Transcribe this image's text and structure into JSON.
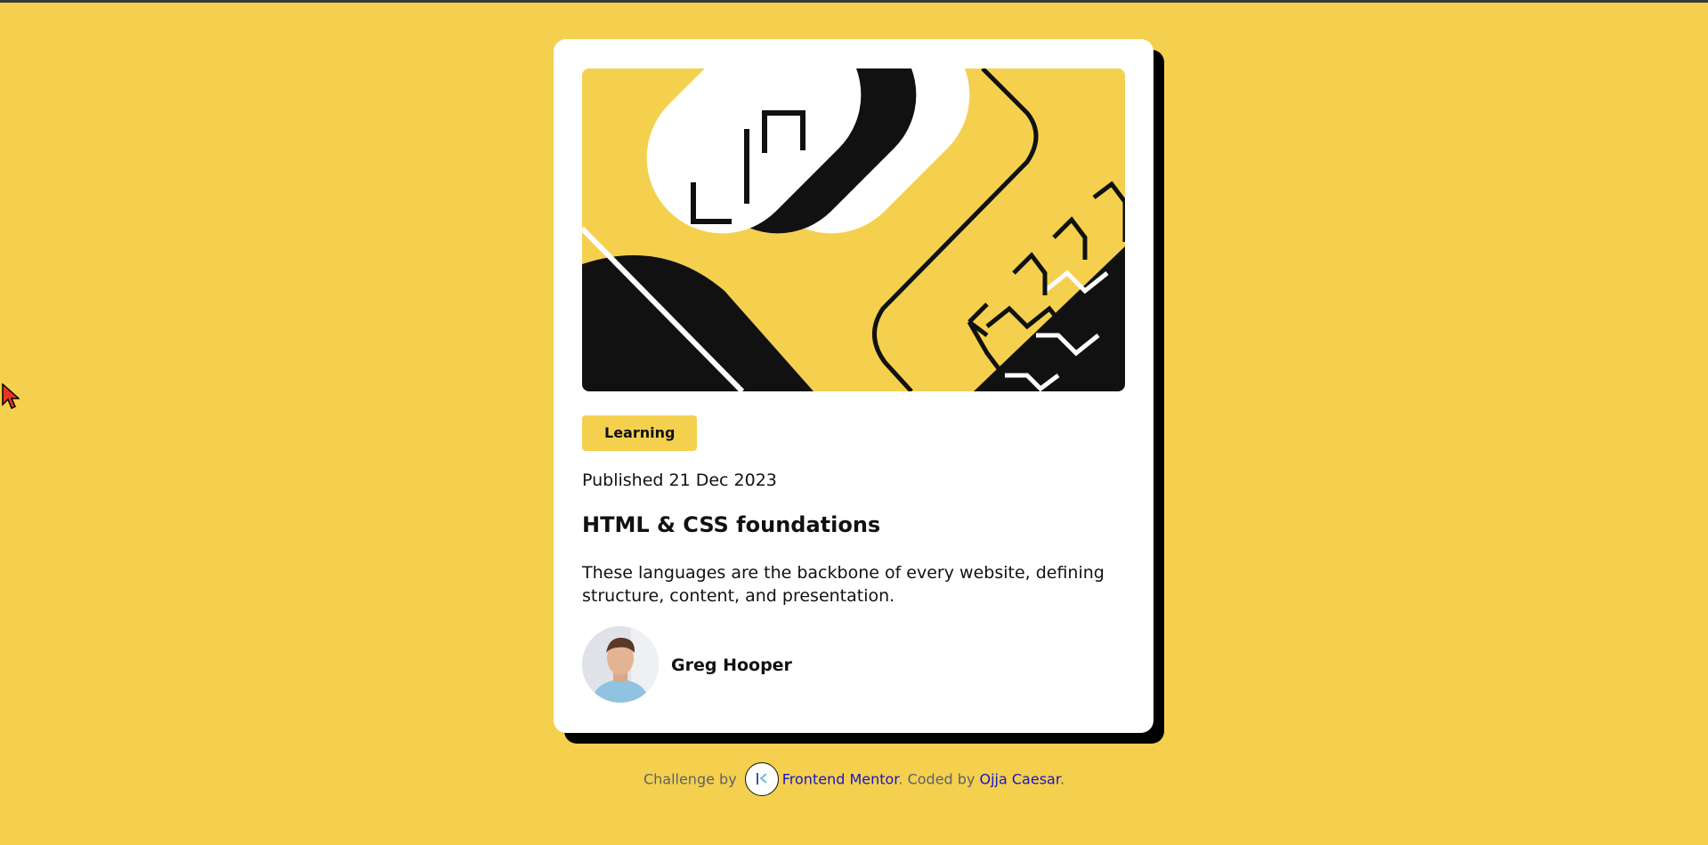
{
  "card": {
    "tag": "Learning",
    "published": "Published 21 Dec 2023",
    "title": "HTML & CSS foundations",
    "description": "These languages are the backbone of every website, defining structure, content, and presentation.",
    "author": "Greg Hooper"
  },
  "attribution": {
    "prefix": "Challenge by",
    "challenge_link": "Frontend Mentor",
    "middle": ". Coded by",
    "coder_link": "Ojja Caesar",
    "suffix": "."
  },
  "colors": {
    "background": "#F4D04E",
    "card": "#FFFFFF",
    "ink": "#111111",
    "link": "#1515C8"
  },
  "icons": {
    "cursor": "mouse-pointer-icon",
    "logo": "frontend-mentor-logo-icon"
  }
}
